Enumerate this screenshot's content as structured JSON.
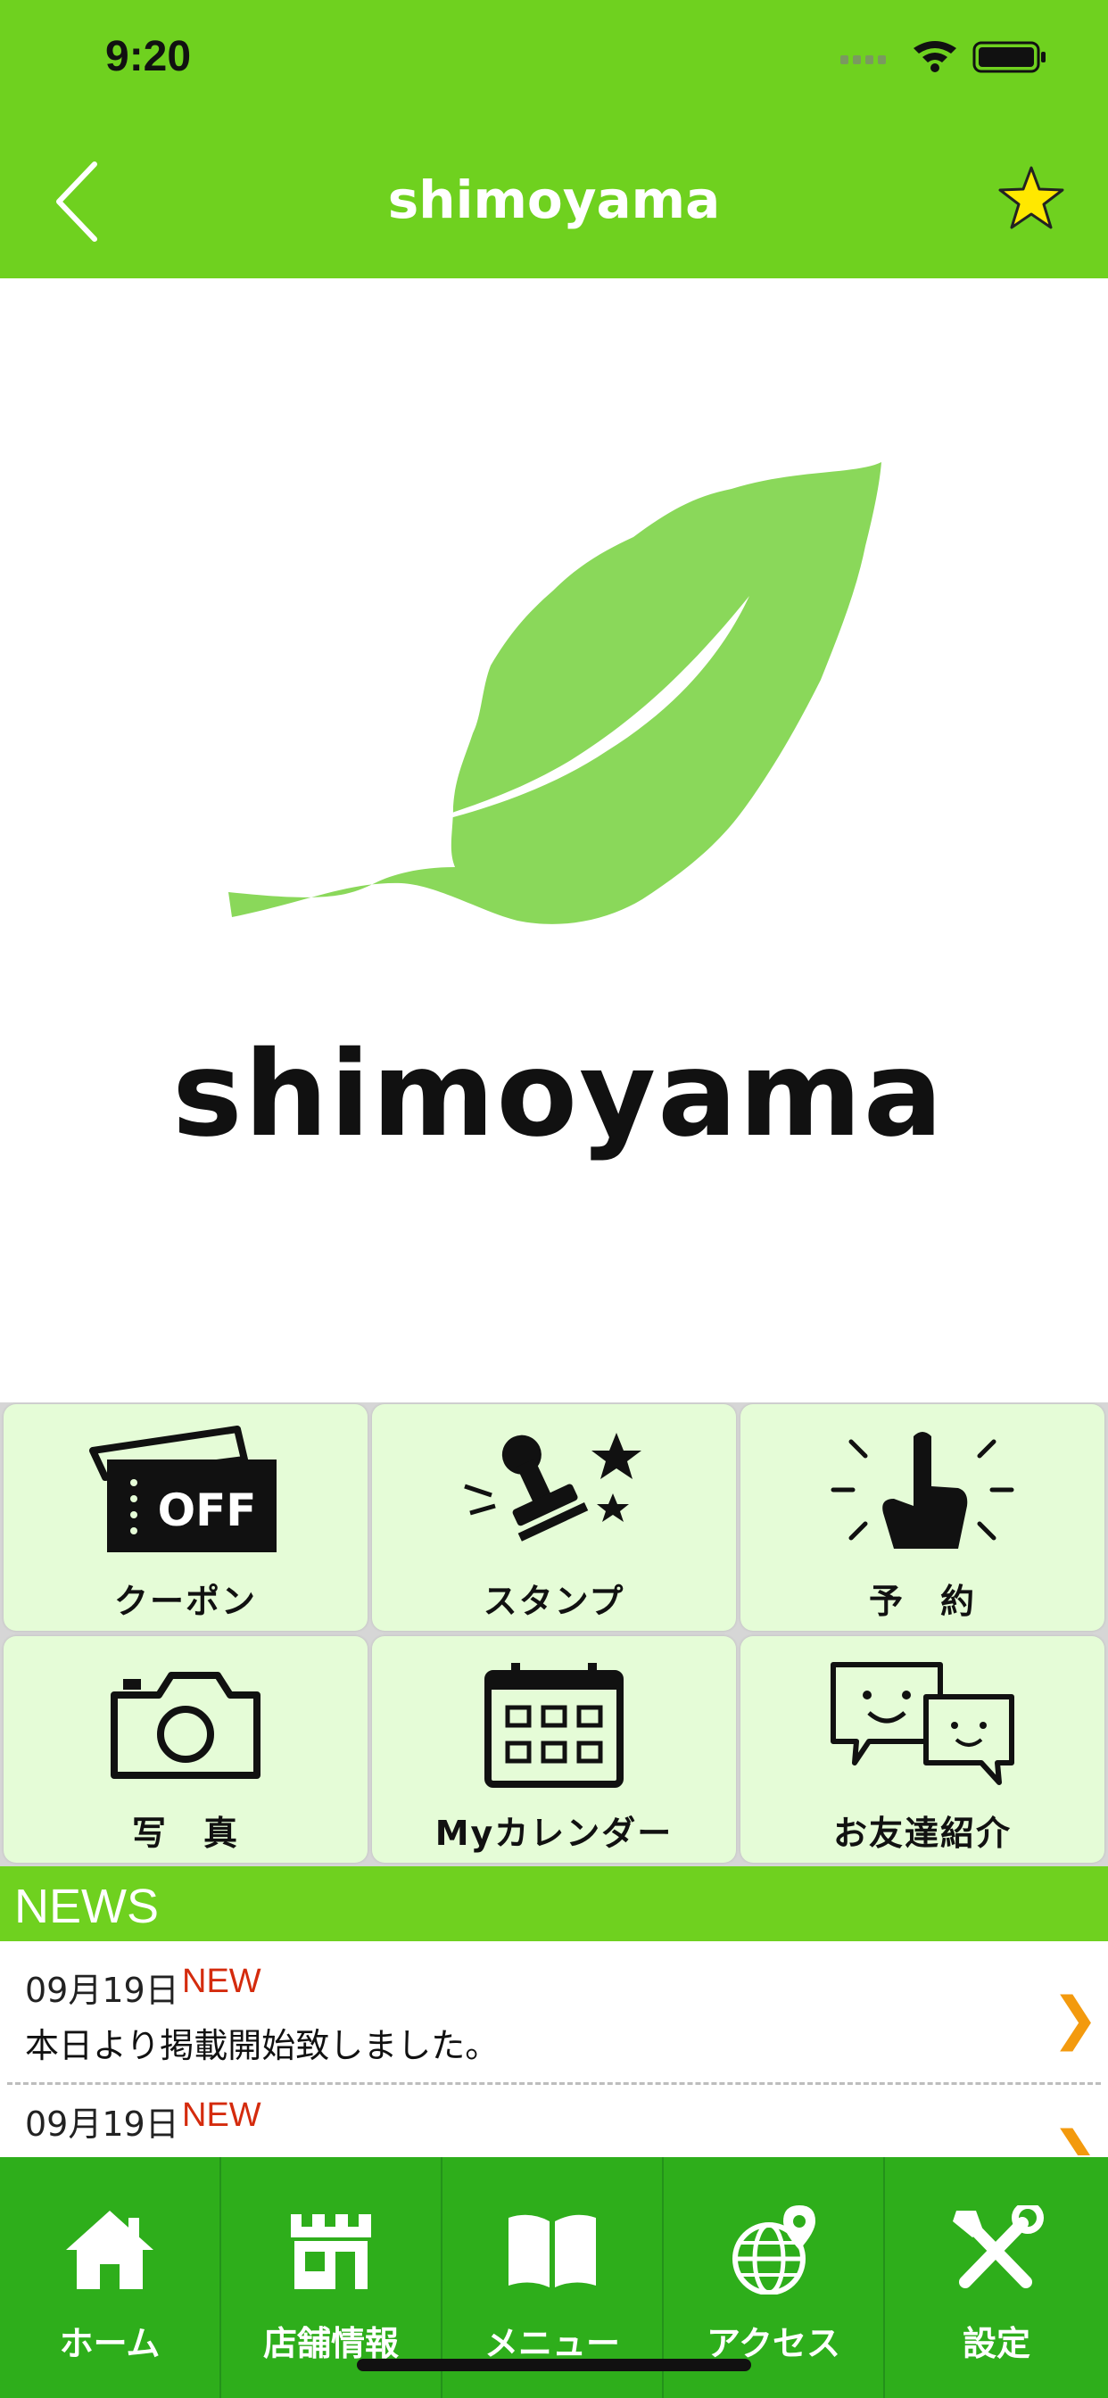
{
  "status_bar": {
    "time": "9:20"
  },
  "nav": {
    "title": "shimoyama"
  },
  "hero": {
    "logo_text": "shimoyama"
  },
  "grid": {
    "items": [
      {
        "label": "クーポン",
        "icon": "coupon-off-icon",
        "off_text": "OFF"
      },
      {
        "label": "スタンプ",
        "icon": "stamp-icon"
      },
      {
        "label": "予　約",
        "icon": "reservation-hand-icon"
      },
      {
        "label": "写　真",
        "icon": "camera-icon"
      },
      {
        "label": "Myカレンダー",
        "icon": "calendar-icon"
      },
      {
        "label": "お友達紹介",
        "icon": "friend-chat-icon"
      }
    ]
  },
  "news": {
    "header": "NEWS",
    "items": [
      {
        "date": "09月19日",
        "badge": "NEW",
        "text": "本日より掲載開始致しました。"
      },
      {
        "date": "09月19日",
        "badge": "NEW",
        "text": ""
      }
    ]
  },
  "tabs": [
    {
      "label": "ホーム",
      "icon": "home-icon"
    },
    {
      "label": "店舗情報",
      "icon": "store-icon"
    },
    {
      "label": "メニュー",
      "icon": "book-icon"
    },
    {
      "label": "アクセス",
      "icon": "globe-pin-icon"
    },
    {
      "label": "設定",
      "icon": "tools-icon"
    }
  ],
  "colors": {
    "header_green": "#6fd11f",
    "tab_green": "#2eae1b",
    "tile_bg": "#e5fcd7",
    "leaf_green": "#8ad85a",
    "news_new": "#d42b0d",
    "chevron": "#f39a0e"
  }
}
